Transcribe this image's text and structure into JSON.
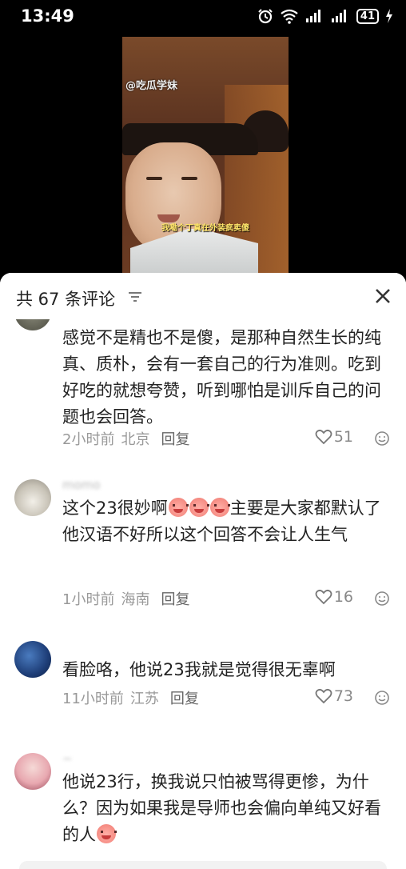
{
  "status_bar": {
    "time": "13:49",
    "battery": "41",
    "icons": [
      "alarm-icon",
      "wifi-icon",
      "signal-icon",
      "signal-icon",
      "battery-icon",
      "charging-icon"
    ]
  },
  "video": {
    "watermark": "@吃瓜学妹",
    "subtitle": "我嘞个丁真在外装疯卖傻"
  },
  "comments_panel": {
    "title": "共 67 条评论",
    "sort_icon": "sort-icon",
    "close_icon": "close-icon"
  },
  "comments": [
    {
      "username": "",
      "text": "感觉不是精也不是傻，是那种自然生长的纯真、质朴，会有一套自己的行为准则。吃到好吃的就想夸赞，听到哪怕是训斥自己的问题也会回答。",
      "time": "2小时前",
      "location": "北京",
      "reply": "回复",
      "likes": "51"
    },
    {
      "username": "momo",
      "text_before": "这个23很妙啊",
      "text_after": "主要是大家都默认了他汉语不好所以这个回答不会让人生气",
      "time": "1小时前",
      "location": "海南",
      "reply": "回复",
      "likes": "16"
    },
    {
      "username": "",
      "text": "看脸咯，他说23我就是觉得很无辜啊",
      "time": "11小时前",
      "location": "江苏",
      "reply": "回复",
      "likes": "73"
    },
    {
      "username": "~",
      "text": "他说23行，换我说只怕被骂得更惨，为什么？因为如果我是导师也会偏向单纯又好看的人"
    }
  ]
}
